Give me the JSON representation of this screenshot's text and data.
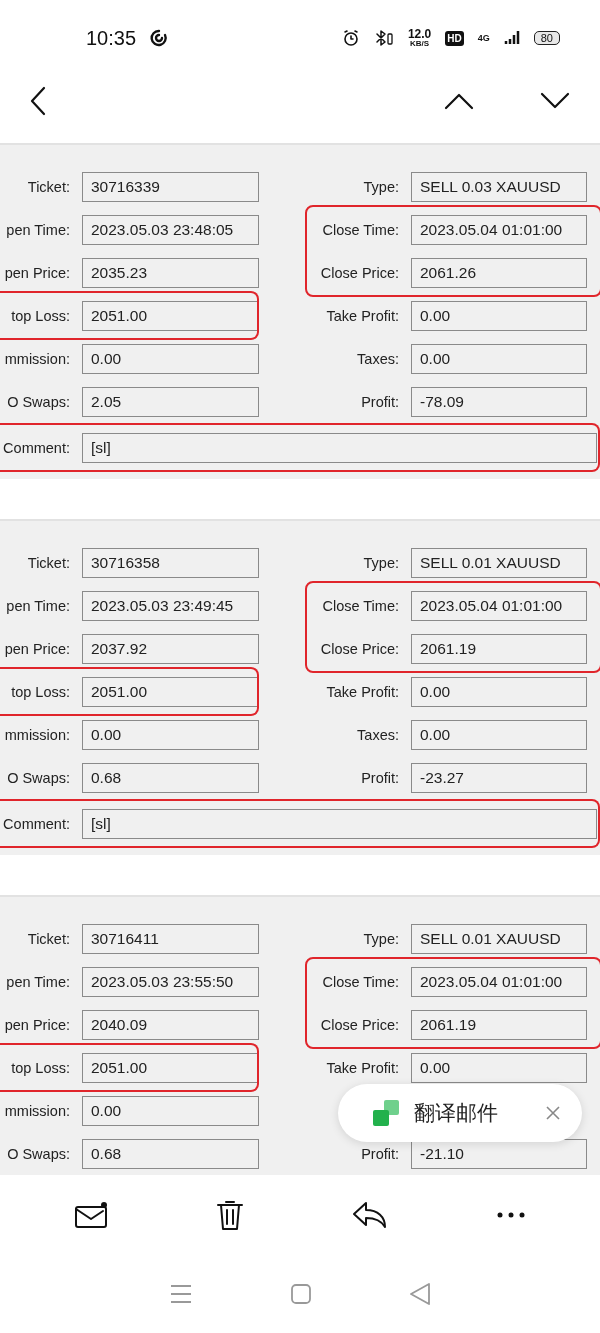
{
  "status_bar": {
    "time": "10:35",
    "speed": "12.0",
    "speed_unit": "KB/S",
    "hd": "HD",
    "network": "4G",
    "battery": "80"
  },
  "panels": [
    {
      "left": [
        {
          "label": "Ticket:",
          "value": "30716339",
          "highlighted": false
        },
        {
          "label": "pen Time:",
          "value": "2023.05.03 23:48:05",
          "highlighted": false
        },
        {
          "label": "pen Price:",
          "value": "2035.23",
          "highlighted": false
        },
        {
          "label": "top Loss:",
          "value": "2051.00",
          "highlighted": true
        },
        {
          "label": "mmission:",
          "value": "0.00",
          "highlighted": false
        },
        {
          "label": "O Swaps:",
          "value": "2.05",
          "highlighted": false
        }
      ],
      "right": [
        {
          "label": "Type:",
          "value": "SELL 0.03 XAUUSD",
          "highlighted": false
        },
        {
          "label": "Close Time:",
          "value": "2023.05.04 01:01:00",
          "highlighted": true
        },
        {
          "label": "Close Price:",
          "value": "2061.26",
          "highlighted": true
        },
        {
          "label": "Take Profit:",
          "value": "0.00",
          "highlighted": false
        },
        {
          "label": "Taxes:",
          "value": "0.00",
          "highlighted": false
        },
        {
          "label": "Profit:",
          "value": "-78.09",
          "highlighted": false
        }
      ],
      "comment": {
        "label": "Comment:",
        "value": "[sl]",
        "highlighted": true
      }
    },
    {
      "left": [
        {
          "label": "Ticket:",
          "value": "30716358",
          "highlighted": false
        },
        {
          "label": "pen Time:",
          "value": "2023.05.03 23:49:45",
          "highlighted": false
        },
        {
          "label": "pen Price:",
          "value": "2037.92",
          "highlighted": false
        },
        {
          "label": "top Loss:",
          "value": "2051.00",
          "highlighted": true
        },
        {
          "label": "mmission:",
          "value": "0.00",
          "highlighted": false
        },
        {
          "label": "O Swaps:",
          "value": "0.68",
          "highlighted": false
        }
      ],
      "right": [
        {
          "label": "Type:",
          "value": "SELL 0.01 XAUUSD",
          "highlighted": false
        },
        {
          "label": "Close Time:",
          "value": "2023.05.04 01:01:00",
          "highlighted": true
        },
        {
          "label": "Close Price:",
          "value": "2061.19",
          "highlighted": true
        },
        {
          "label": "Take Profit:",
          "value": "0.00",
          "highlighted": false
        },
        {
          "label": "Taxes:",
          "value": "0.00",
          "highlighted": false
        },
        {
          "label": "Profit:",
          "value": "-23.27",
          "highlighted": false
        }
      ],
      "comment": {
        "label": "Comment:",
        "value": "[sl]",
        "highlighted": true
      }
    },
    {
      "left": [
        {
          "label": "Ticket:",
          "value": "30716411",
          "highlighted": false
        },
        {
          "label": "pen Time:",
          "value": "2023.05.03 23:55:50",
          "highlighted": false
        },
        {
          "label": "pen Price:",
          "value": "2040.09",
          "highlighted": false
        },
        {
          "label": "top Loss:",
          "value": "2051.00",
          "highlighted": true
        },
        {
          "label": "mmission:",
          "value": "0.00",
          "highlighted": false
        },
        {
          "label": "O Swaps:",
          "value": "0.68",
          "highlighted": false
        }
      ],
      "right": [
        {
          "label": "Type:",
          "value": "SELL 0.01 XAUUSD",
          "highlighted": false
        },
        {
          "label": "Close Time:",
          "value": "2023.05.04 01:01:00",
          "highlighted": true
        },
        {
          "label": "Close Price:",
          "value": "2061.19",
          "highlighted": true
        },
        {
          "label": "Take Profit:",
          "value": "0.00",
          "highlighted": false
        },
        {
          "kind": "covered"
        },
        {
          "label": "Profit:",
          "value": "-21.10",
          "highlighted": false
        }
      ]
    }
  ],
  "toast": {
    "text": "翻译邮件"
  }
}
